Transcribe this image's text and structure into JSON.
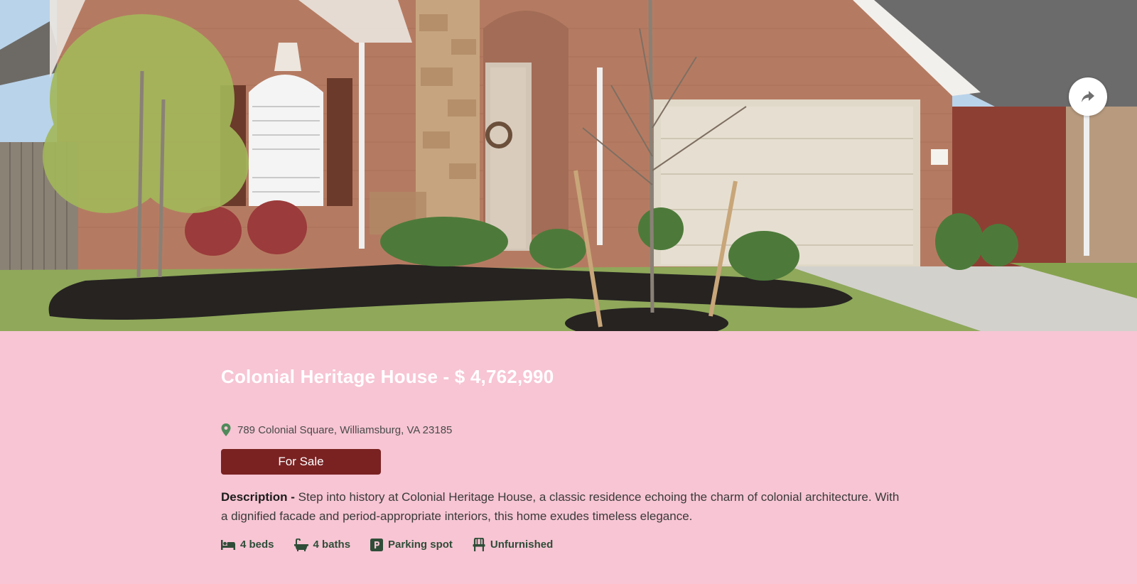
{
  "listing": {
    "title": "Colonial Heritage House - $ 4,762,990",
    "address": "789 Colonial Square, Williamsburg, VA 23185",
    "status": "For Sale",
    "description_label": "Description -",
    "description": " Step into history at Colonial Heritage House, a classic residence echoing the charm of colonial architecture. With a dignified facade and period-appropriate interiors, this home exudes timeless elegance."
  },
  "features": [
    {
      "label": "4 beds",
      "icon": "bed-icon"
    },
    {
      "label": "4 baths",
      "icon": "bathtub-icon"
    },
    {
      "label": "Parking spot",
      "icon": "parking-icon"
    },
    {
      "label": "Unfurnished",
      "icon": "chair-icon"
    }
  ],
  "hero_image": {
    "alt": "house-photo"
  },
  "share": {
    "icon": "share-icon"
  },
  "colors": {
    "background": "#f7c5d4",
    "status_badge": "#7a2222",
    "feature_text": "#2f4d38",
    "pin": "#4f8a5b"
  }
}
